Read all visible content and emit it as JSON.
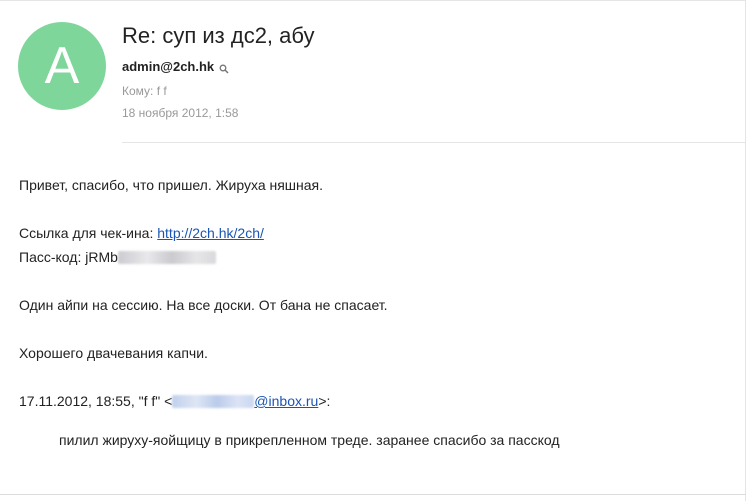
{
  "message": {
    "avatar_letter": "A",
    "avatar_color": "#7ed69b",
    "subject": "Re: суп из дс2, абу",
    "sender": "admin@2ch.hk",
    "recipients": "Кому: f f",
    "date": "18 ноября 2012, 1:58"
  },
  "body": {
    "greeting": "Привет, спасибо, что пришел. Жируха няшная.",
    "checkin_label": "Ссылка для чек-ина: ",
    "checkin_link": "http://2ch.hk/2ch/",
    "passcode_label": "Пасс-код: jRMb",
    "one_ip": "Один айпи на сессию. На все доски. От бана не спасает.",
    "farewell": "Хорошего двачевания капчи.",
    "quote_header_prefix": "17.11.2012, 18:55, \"f f\" <",
    "quote_email_domain": "@inbox.ru",
    "quote_header_suffix": ">:",
    "quoted_text": "пилил жируху-яойщицу в прикрепленном треде. заранее спасибо за пасскод"
  },
  "colors": {
    "link": "#1a55b5",
    "muted": "#999999",
    "text": "#222222"
  }
}
